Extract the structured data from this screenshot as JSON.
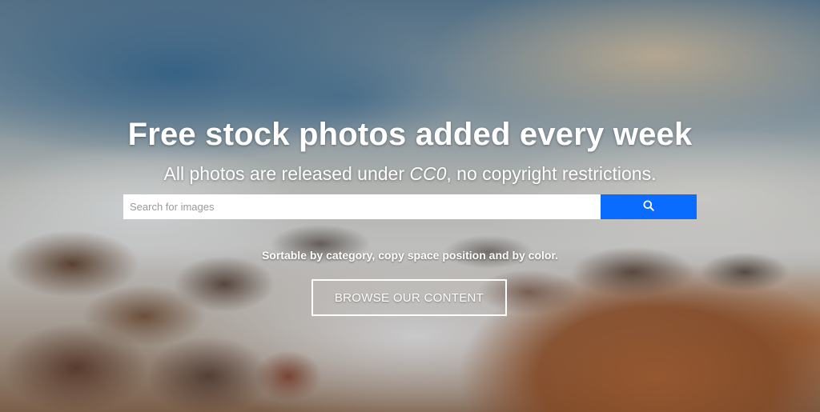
{
  "hero": {
    "headline": "Free stock photos added every week",
    "subline_before": "All photos are released under ",
    "subline_license": "CC0",
    "subline_after": ", no copyright restrictions.",
    "tagline": "Sortable by category, copy space position and by color.",
    "background_scene": "ocean waves crashing on rocks"
  },
  "search": {
    "placeholder": "Search for images",
    "value": "",
    "button_icon": "search-icon",
    "button_color": "#0a6cff"
  },
  "browse": {
    "label": "BROWSE OUR CONTENT"
  }
}
